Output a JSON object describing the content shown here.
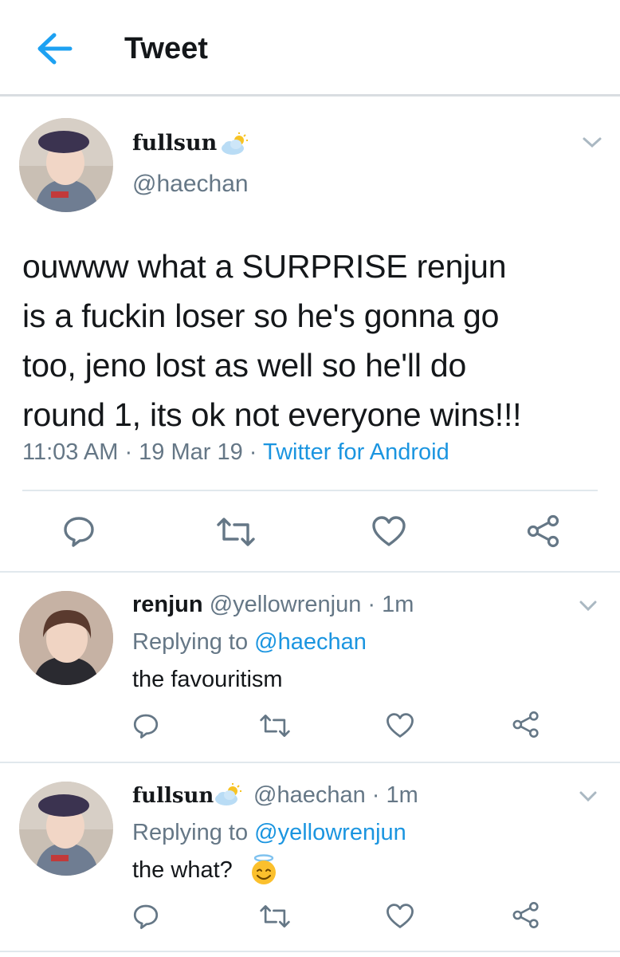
{
  "header": {
    "title": "Tweet"
  },
  "main_tweet": {
    "display_name": "fullsun",
    "handle": "@haechan",
    "text_lines": [
      "ouwww what a SURPRISE renjun",
      "is a fuckin loser so he's gonna go",
      "too, jeno lost as well so he'll do",
      "round 1, its ok not everyone wins!!!"
    ],
    "time": "11:03 AM",
    "sep1": " · ",
    "date": "19 Mar 19",
    "sep2": " · ",
    "source": "Twitter for Android"
  },
  "replies": [
    {
      "display_name": "renjun",
      "handle": "@yellowrenjun",
      "sep": " · ",
      "age": "1m",
      "replying_prefix": "Replying to ",
      "replying_to": "@haechan",
      "text": "the favouritism"
    },
    {
      "display_name": "fullsun",
      "handle": "@haechan",
      "sep": " · ",
      "age": "1m",
      "replying_prefix": "Replying to ",
      "replying_to": "@yellowrenjun",
      "text": "the what?"
    }
  ],
  "colors": {
    "link": "#1b95e0",
    "secondary_text": "#657786",
    "icon": "#657786",
    "divider": "#e1e8ed"
  },
  "icons": [
    "back-arrow-icon",
    "chevron-down-icon",
    "reply-icon",
    "retweet-icon",
    "like-icon",
    "share-icon",
    "sun-cloud-emoji",
    "halo-smile-emoji"
  ]
}
